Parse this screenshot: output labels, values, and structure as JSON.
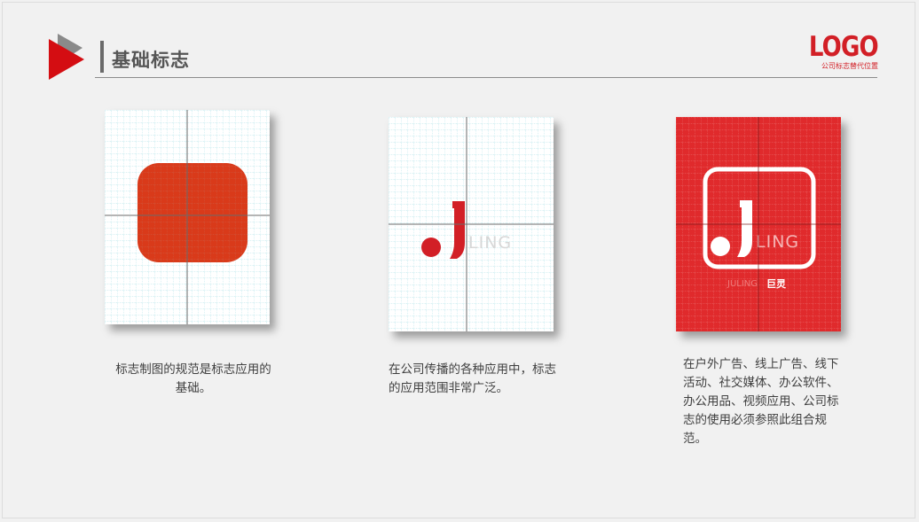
{
  "header": {
    "title": "基础标志",
    "logo_text": "LOGO",
    "logo_subtitle": "公司标志替代位置"
  },
  "cards": [
    {
      "caption": "标志制图的规范是标志应用的基础。"
    },
    {
      "caption": "在公司传播的各种应用中，标志的应用范围非常广泛。",
      "wordmark": "LING"
    },
    {
      "caption": "在户外广告、线上广告、线下活动、社交媒体、办公软件、办公用品、视频应用、公司标志的使用必须参照此组合规范。",
      "wordmark": "LING",
      "brand_cn": "巨灵",
      "brand_en": "JULING"
    }
  ],
  "colors": {
    "brand_red": "#d21f26",
    "mark_red": "#d93a1a",
    "card3_bg": "#e02a2c",
    "grid_cyan": "#a8e4ea",
    "text": "#3f3f3f"
  }
}
